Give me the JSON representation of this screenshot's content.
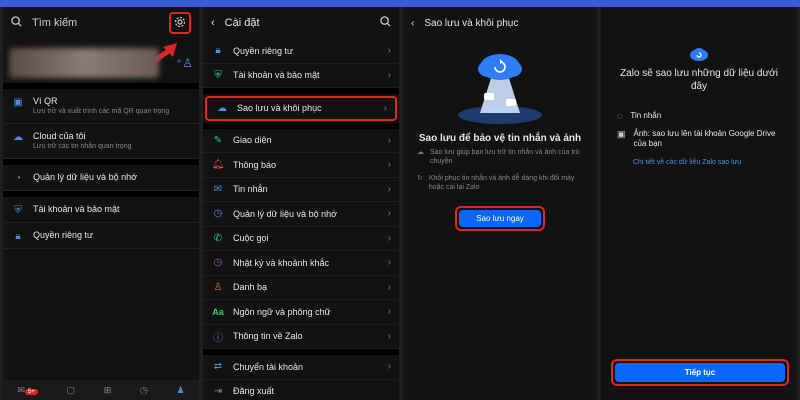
{
  "screen1": {
    "search_placeholder": "Tìm kiếm",
    "items": [
      {
        "label": "Ví QR",
        "sub": "Lưu trữ và xuất trình các mã QR quan trọng"
      },
      {
        "label": "Cloud của tôi",
        "sub": "Lưu trữ các tin nhắn quan trọng"
      },
      {
        "label": "Quản lý dữ liệu và bộ nhớ",
        "sub": ""
      },
      {
        "label": "Tài khoản và bảo mật",
        "sub": ""
      },
      {
        "label": "Quyền riêng tư",
        "sub": ""
      }
    ],
    "badge": "5+"
  },
  "screen2": {
    "title": "Cài đặt",
    "items": [
      {
        "label": "Quyền riêng tư",
        "icon": "lock-icon",
        "color": "#4a90e2"
      },
      {
        "label": "Tài khoản và bảo mật",
        "icon": "shield-icon",
        "color": "#2ecc71"
      },
      {
        "label": "Sao lưu và khôi phục",
        "icon": "cloud-icon",
        "color": "#4a90e2"
      },
      {
        "label": "Giao diện",
        "icon": "brush-icon",
        "color": "#2ecc71"
      },
      {
        "label": "Thông báo",
        "icon": "bell-icon",
        "color": "#e74c3c"
      },
      {
        "label": "Tin nhắn",
        "icon": "chat-icon",
        "color": "#4a90e2"
      },
      {
        "label": "Quản lý dữ liệu và bộ nhớ",
        "icon": "clock-icon",
        "color": "#4a90e2"
      },
      {
        "label": "Cuộc gọi",
        "icon": "phone-icon",
        "color": "#2ecc71"
      },
      {
        "label": "Nhật ký và khoảnh khắc",
        "icon": "clock-icon",
        "color": "#9b59b6"
      },
      {
        "label": "Danh bạ",
        "icon": "person-icon",
        "color": "#e67e22"
      },
      {
        "label": "Ngôn ngữ và phông chữ",
        "icon": "font-icon",
        "color": "#2ecc71"
      },
      {
        "label": "Thông tin về Zalo",
        "icon": "info-icon",
        "color": "#4a90e2"
      },
      {
        "label": "Chuyển tài khoản",
        "icon": "switch-icon",
        "color": "#4a90e2"
      },
      {
        "label": "Đăng xuất",
        "icon": "logout-icon",
        "color": "#888"
      }
    ]
  },
  "screen3": {
    "title": "Sao lưu và khôi phục",
    "heading": "Sao lưu để bảo vệ tin nhắn và ảnh",
    "bullet1": "Sao lưu giúp bạn lưu trữ tin nhắn và ảnh của trò chuyện",
    "bullet2": "Khôi phục tin nhắn và ảnh dễ dàng khi đổi máy hoặc cài lại Zalo",
    "button": "Sao lưu ngay"
  },
  "screen4": {
    "title": "Zalo sẽ sao lưu những dữ liệu dưới đây",
    "item1": "Tin nhắn",
    "item2": "Ảnh: sao lưu lên tài khoản Google Drive của bạn",
    "link": "Chi tiết về các dữ liệu Zalo sao lưu",
    "button": "Tiếp tục"
  }
}
